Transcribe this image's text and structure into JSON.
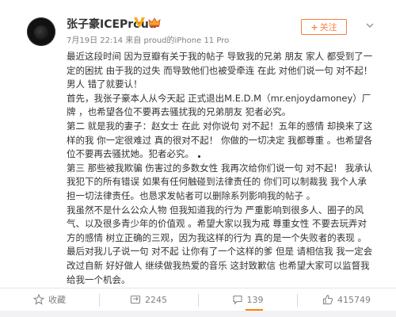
{
  "post": {
    "username": "张子豪ICEProud",
    "timestamp": "7月19日 22:14",
    "source_prefix": "来自",
    "source": "proud的iPhone 11 Pro",
    "follow_label": "关注",
    "follow_plus": "+",
    "paragraphs": [
      "最近这段时间 因为豆瓣有关于我的帖子 导致我的兄弟 朋友 家人 都受到了一定的困扰 由于我的过失 而导致他们也被受牵连 在此 对他们说一句 对不起！男人 错了就要认！",
      "首先，我张子豪本人从今天起 正式退出M.E.D.M（mr.enjoydamoney）厂牌 ，也希望各位不要再去骚扰我的兄弟朋友 犯者必究。",
      "第二 就是我的妻子：赵女士 在此 对你说句 对不起！五年的感情 却换来了这样的我 你一定很难过 真的很对不起！ 你做的一切决定 我都尊重 。也希望各位不要再去骚扰她。犯者必究。",
      "第三 那些被我欺骗 伤害过的多数女性 我再次给你们说一句 对不起！ 我承认我犯下的所有错误 如果有任何触碰到法律责任的 你们可以制裁我 我个人承担一切法律责任。也恳求发帖者可以删除系列影响我的帖子 。",
      "我虽然不是什么公众人物 但我知道我的行为 严重影响到很多人、圈子的风气、以及很多青少年的价值观 。希望大家以我为戒 尊重女性 不要去玩弄对方的感情 树立正确的三观，因为我这样的行为 真的是一个失败者的表现 。",
      "最后对我儿子说一句 对不起 让你有了一个这样的爹 但是 请相信我 我一定会改过自新 好好做人 继续做我热爱的音乐 这封致歉信 也希望大家可以监督我 给我一个机会。"
    ]
  },
  "actions": {
    "favorite": "收藏",
    "repost": "2245",
    "comment": "139",
    "like": "415749"
  },
  "icons": {
    "verified": "vip-v-icon",
    "member": "crown-icon",
    "more": "chevron-down-icon",
    "favorite": "star-icon",
    "repost": "repost-icon",
    "comment": "comment-icon",
    "like": "thumbs-up-icon"
  },
  "colors": {
    "accent": "#ff8140",
    "verified": "#f9a815",
    "text": "#333333",
    "meta": "#808080"
  }
}
